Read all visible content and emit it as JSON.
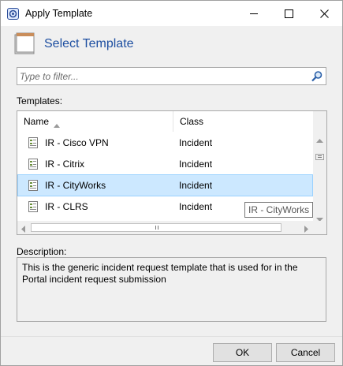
{
  "window": {
    "title": "Apply Template",
    "icon": "app-template-icon"
  },
  "header": {
    "title": "Select Template",
    "icon": "blank-page-icon"
  },
  "filter": {
    "placeholder": "Type to filter...",
    "value": "",
    "icon": "search-icon"
  },
  "templates": {
    "label": "Templates:",
    "columns": [
      "Name",
      "Class"
    ],
    "sort_column": "Name",
    "rows": [
      {
        "name": "IR - Cisco VPN",
        "class": "Incident",
        "selected": false
      },
      {
        "name": "IR - Citrix",
        "class": "Incident",
        "selected": false
      },
      {
        "name": "IR - CityWorks",
        "class": "Incident",
        "selected": true
      },
      {
        "name": "IR - CLRS",
        "class": "Incident",
        "selected": false
      }
    ],
    "tooltip": "IR - CityWorks"
  },
  "description": {
    "label": "Description:",
    "text": "This is the generic incident request template that is used for in the Portal incident request submission"
  },
  "buttons": {
    "ok": "OK",
    "cancel": "Cancel"
  },
  "colors": {
    "accent_title": "#1e4fa1",
    "selection_bg": "#cce8ff",
    "selection_border": "#99d1ff"
  }
}
